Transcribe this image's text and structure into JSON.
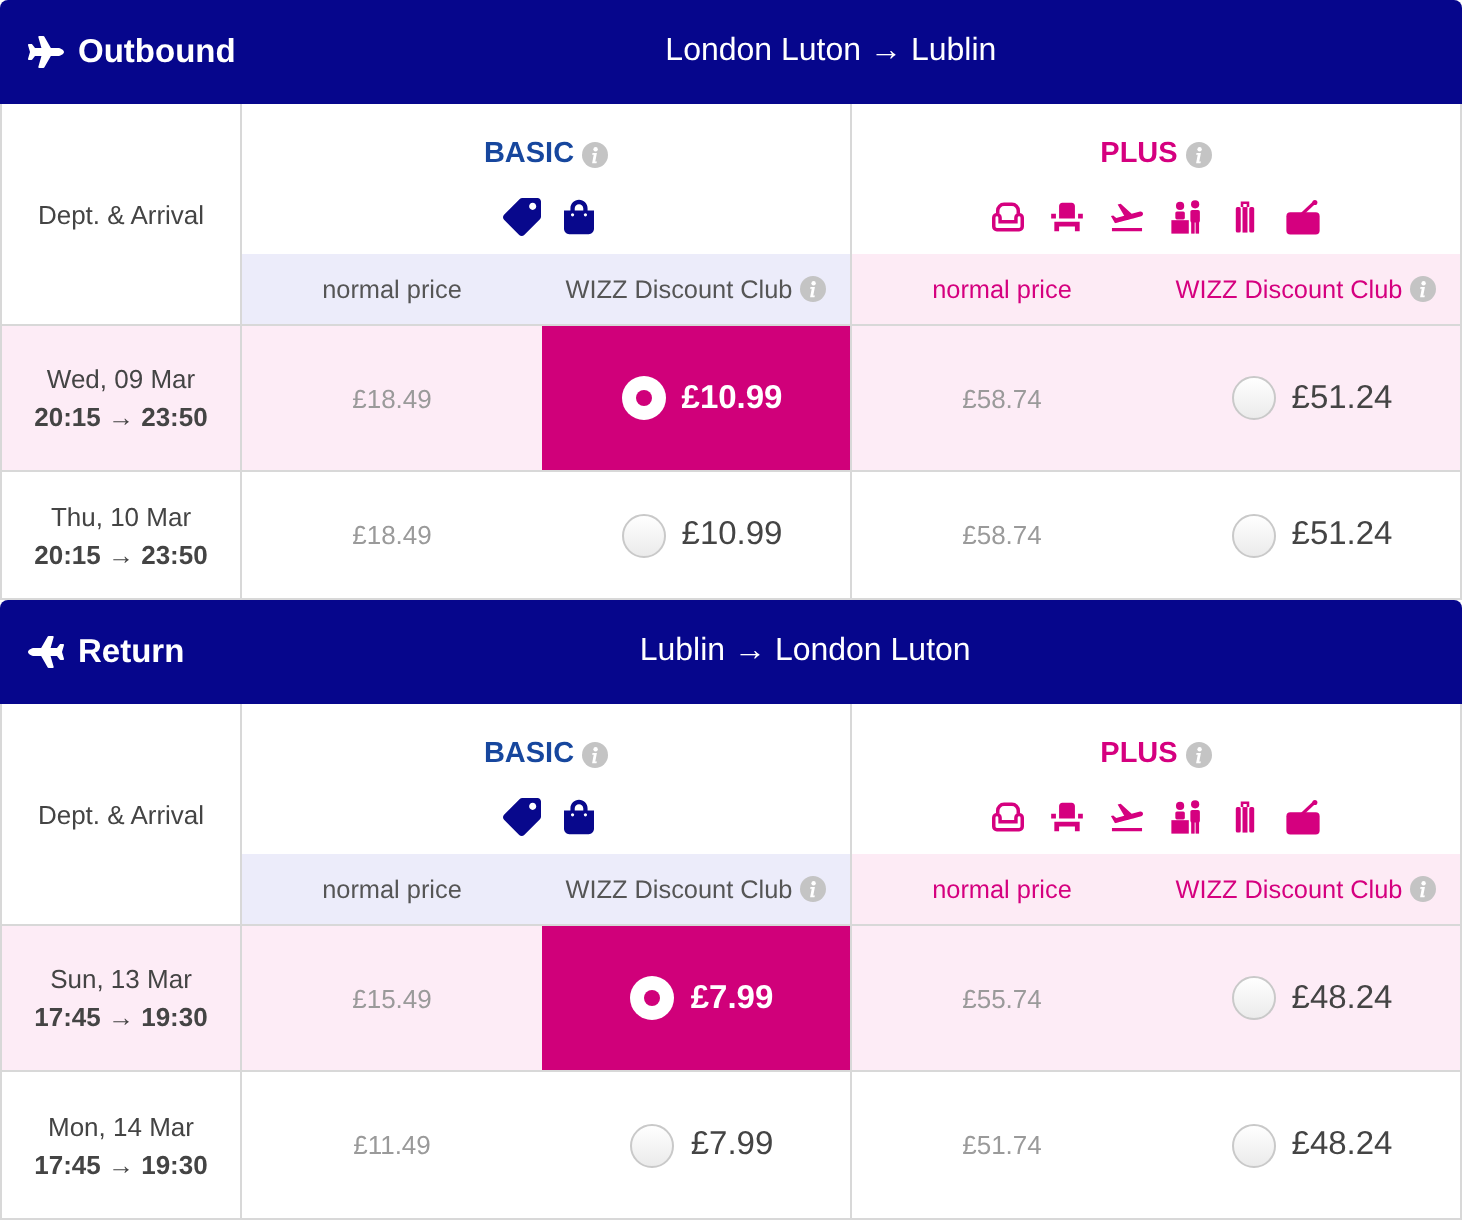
{
  "sections": [
    {
      "kind": "outbound",
      "title": "Outbound",
      "route": "London Luton → Lublin",
      "date_heading": "Dept. & Arrival",
      "fares": [
        {
          "kind": "basic",
          "name": "BASIC",
          "normal_label": "normal price",
          "club_label": "WIZZ Discount Club"
        },
        {
          "kind": "plus",
          "name": "PLUS",
          "normal_label": "normal price",
          "club_label": "WIZZ Discount Club"
        }
      ],
      "rows": [
        {
          "date": "Wed, 09 Mar",
          "times": "20:15 → 23:50",
          "prices": [
            {
              "normal": "£18.49",
              "club": "£10.99",
              "selected": true
            },
            {
              "normal": "£58.74",
              "club": "£51.24",
              "selected": false
            }
          ]
        },
        {
          "date": "Thu, 10 Mar",
          "times": "20:15 → 23:50",
          "prices": [
            {
              "normal": "£18.49",
              "club": "£10.99",
              "selected": false
            },
            {
              "normal": "£58.74",
              "club": "£51.24",
              "selected": false
            }
          ]
        }
      ]
    },
    {
      "kind": "return",
      "title": "Return",
      "route": "Lublin → London Luton",
      "date_heading": "Dept. & Arrival",
      "fares": [
        {
          "kind": "basic",
          "name": "BASIC",
          "normal_label": "normal price",
          "club_label": "WIZZ Discount Club"
        },
        {
          "kind": "plus",
          "name": "PLUS",
          "normal_label": "normal price",
          "club_label": "WIZZ Discount Club"
        }
      ],
      "rows": [
        {
          "date": "Sun, 13 Mar",
          "times": "17:45 → 19:30",
          "prices": [
            {
              "normal": "£15.49",
              "club": "£7.99",
              "selected": true
            },
            {
              "normal": "£55.74",
              "club": "£48.24",
              "selected": false
            }
          ]
        },
        {
          "date": "Mon, 14 Mar",
          "times": "17:45 → 19:30",
          "prices": [
            {
              "normal": "£11.49",
              "club": "£7.99",
              "selected": false
            },
            {
              "normal": "£51.74",
              "club": "£48.24",
              "selected": false
            }
          ]
        }
      ]
    }
  ]
}
